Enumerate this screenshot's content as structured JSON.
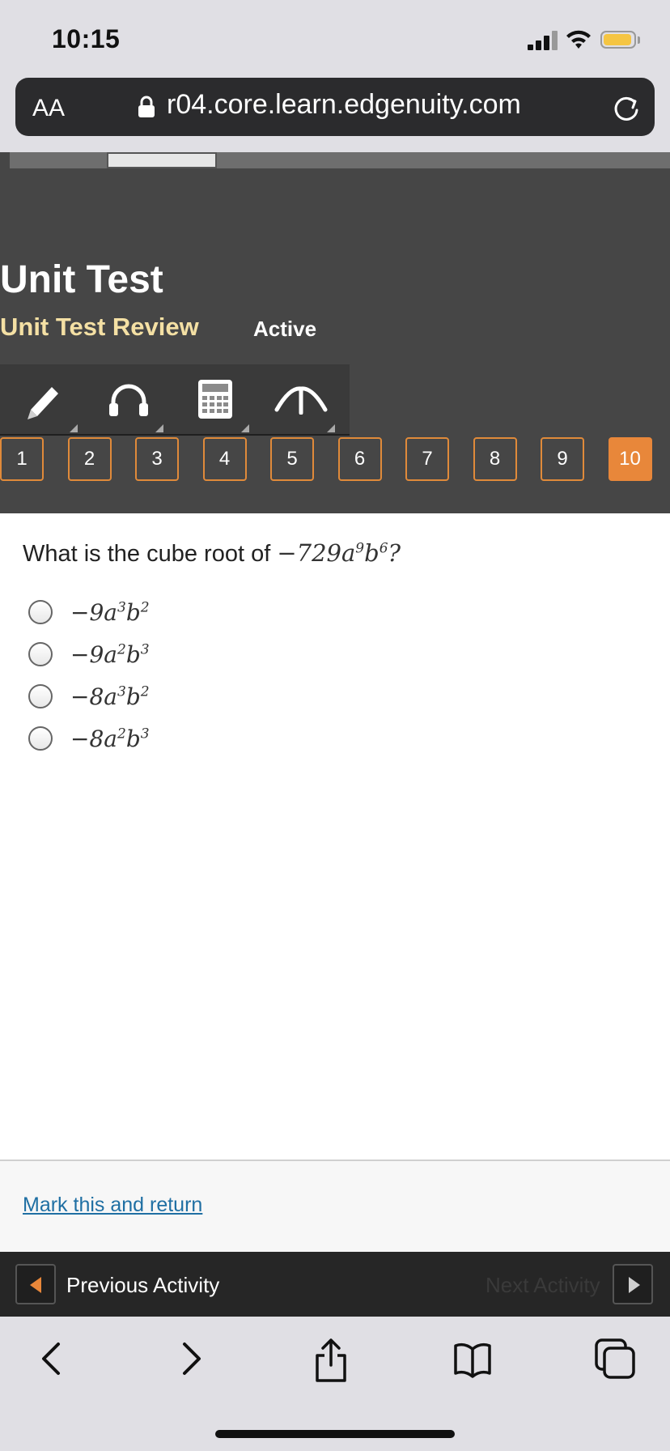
{
  "status_bar": {
    "time": "10:15"
  },
  "browser": {
    "text_size_label": "AA",
    "url": "r04.core.learn.edgenuity.com"
  },
  "page": {
    "title": "Unit Test",
    "subtitle": "Unit Test Review",
    "status": "Active"
  },
  "toolbar": {
    "tools": [
      "pencil-icon",
      "headphones-icon",
      "calculator-icon",
      "reference-icon"
    ]
  },
  "question_nav": {
    "items": [
      "1",
      "2",
      "3",
      "4",
      "5",
      "6",
      "7",
      "8",
      "9",
      "10"
    ],
    "current": "10",
    "accent": "#e8873a"
  },
  "question": {
    "prompt": "What is the cube root of",
    "expr": {
      "coef": "−729",
      "v1": "a",
      "e1": "9",
      "v2": "b",
      "e2": "6",
      "end": "?"
    },
    "options": [
      {
        "coef": "−9",
        "v1": "a",
        "e1": "3",
        "v2": "b",
        "e2": "2"
      },
      {
        "coef": "−9",
        "v1": "a",
        "e1": "2",
        "v2": "b",
        "e2": "3"
      },
      {
        "coef": "−8",
        "v1": "a",
        "e1": "3",
        "v2": "b",
        "e2": "2"
      },
      {
        "coef": "−8",
        "v1": "a",
        "e1": "2",
        "v2": "b",
        "e2": "3"
      }
    ]
  },
  "footer": {
    "mark_label": "Mark this and return",
    "prev_label": "Previous Activity",
    "next_label": "Next Activity"
  }
}
